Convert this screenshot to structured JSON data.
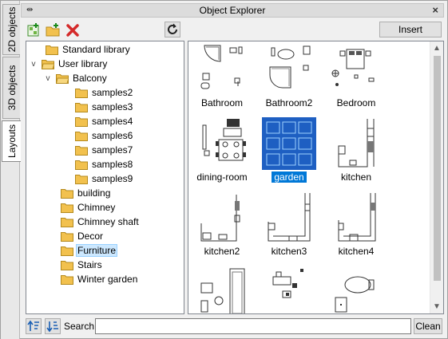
{
  "window": {
    "title": "Object Explorer"
  },
  "vtabs": [
    {
      "label": "2D objects"
    },
    {
      "label": "3D objects"
    },
    {
      "label": "Layouts"
    }
  ],
  "toolbar": {
    "insert_label": "Insert",
    "icons": [
      "add-object-icon",
      "new-folder-icon",
      "delete-icon",
      "refresh-icon"
    ]
  },
  "tree": {
    "items": [
      {
        "label": "Standard library",
        "expander": ""
      },
      {
        "label": "User library",
        "expander": "v"
      },
      {
        "label": "Balcony",
        "expander": "v"
      },
      {
        "label": "samples2",
        "expander": ""
      },
      {
        "label": "samples3",
        "expander": ""
      },
      {
        "label": "samples4",
        "expander": ""
      },
      {
        "label": "samples6",
        "expander": ""
      },
      {
        "label": "samples7",
        "expander": ""
      },
      {
        "label": "samples8",
        "expander": ""
      },
      {
        "label": "samples9",
        "expander": ""
      },
      {
        "label": "building",
        "expander": ""
      },
      {
        "label": "Chimney",
        "expander": ""
      },
      {
        "label": "Chimney shaft",
        "expander": ""
      },
      {
        "label": "Decor",
        "expander": ""
      },
      {
        "label": "Furniture",
        "expander": "",
        "selected": true
      },
      {
        "label": "Stairs",
        "expander": ""
      },
      {
        "label": "Winter garden",
        "expander": ""
      }
    ]
  },
  "grid": {
    "items": [
      {
        "label": "Bathroom"
      },
      {
        "label": "Bathroom2"
      },
      {
        "label": "Bedroom"
      },
      {
        "label": "dining-room"
      },
      {
        "label": "garden",
        "selected": true
      },
      {
        "label": "kitchen"
      },
      {
        "label": "kitchen2"
      },
      {
        "label": "kitchen3"
      },
      {
        "label": "kitchen4"
      },
      {
        "label": ""
      },
      {
        "label": ""
      },
      {
        "label": ""
      }
    ]
  },
  "search": {
    "label": "Search:",
    "value": "",
    "clean_label": "Clean"
  },
  "colors": {
    "selection": "#0078d7",
    "tree_selection": "#cce8ff",
    "folder": "#f2c14e"
  }
}
